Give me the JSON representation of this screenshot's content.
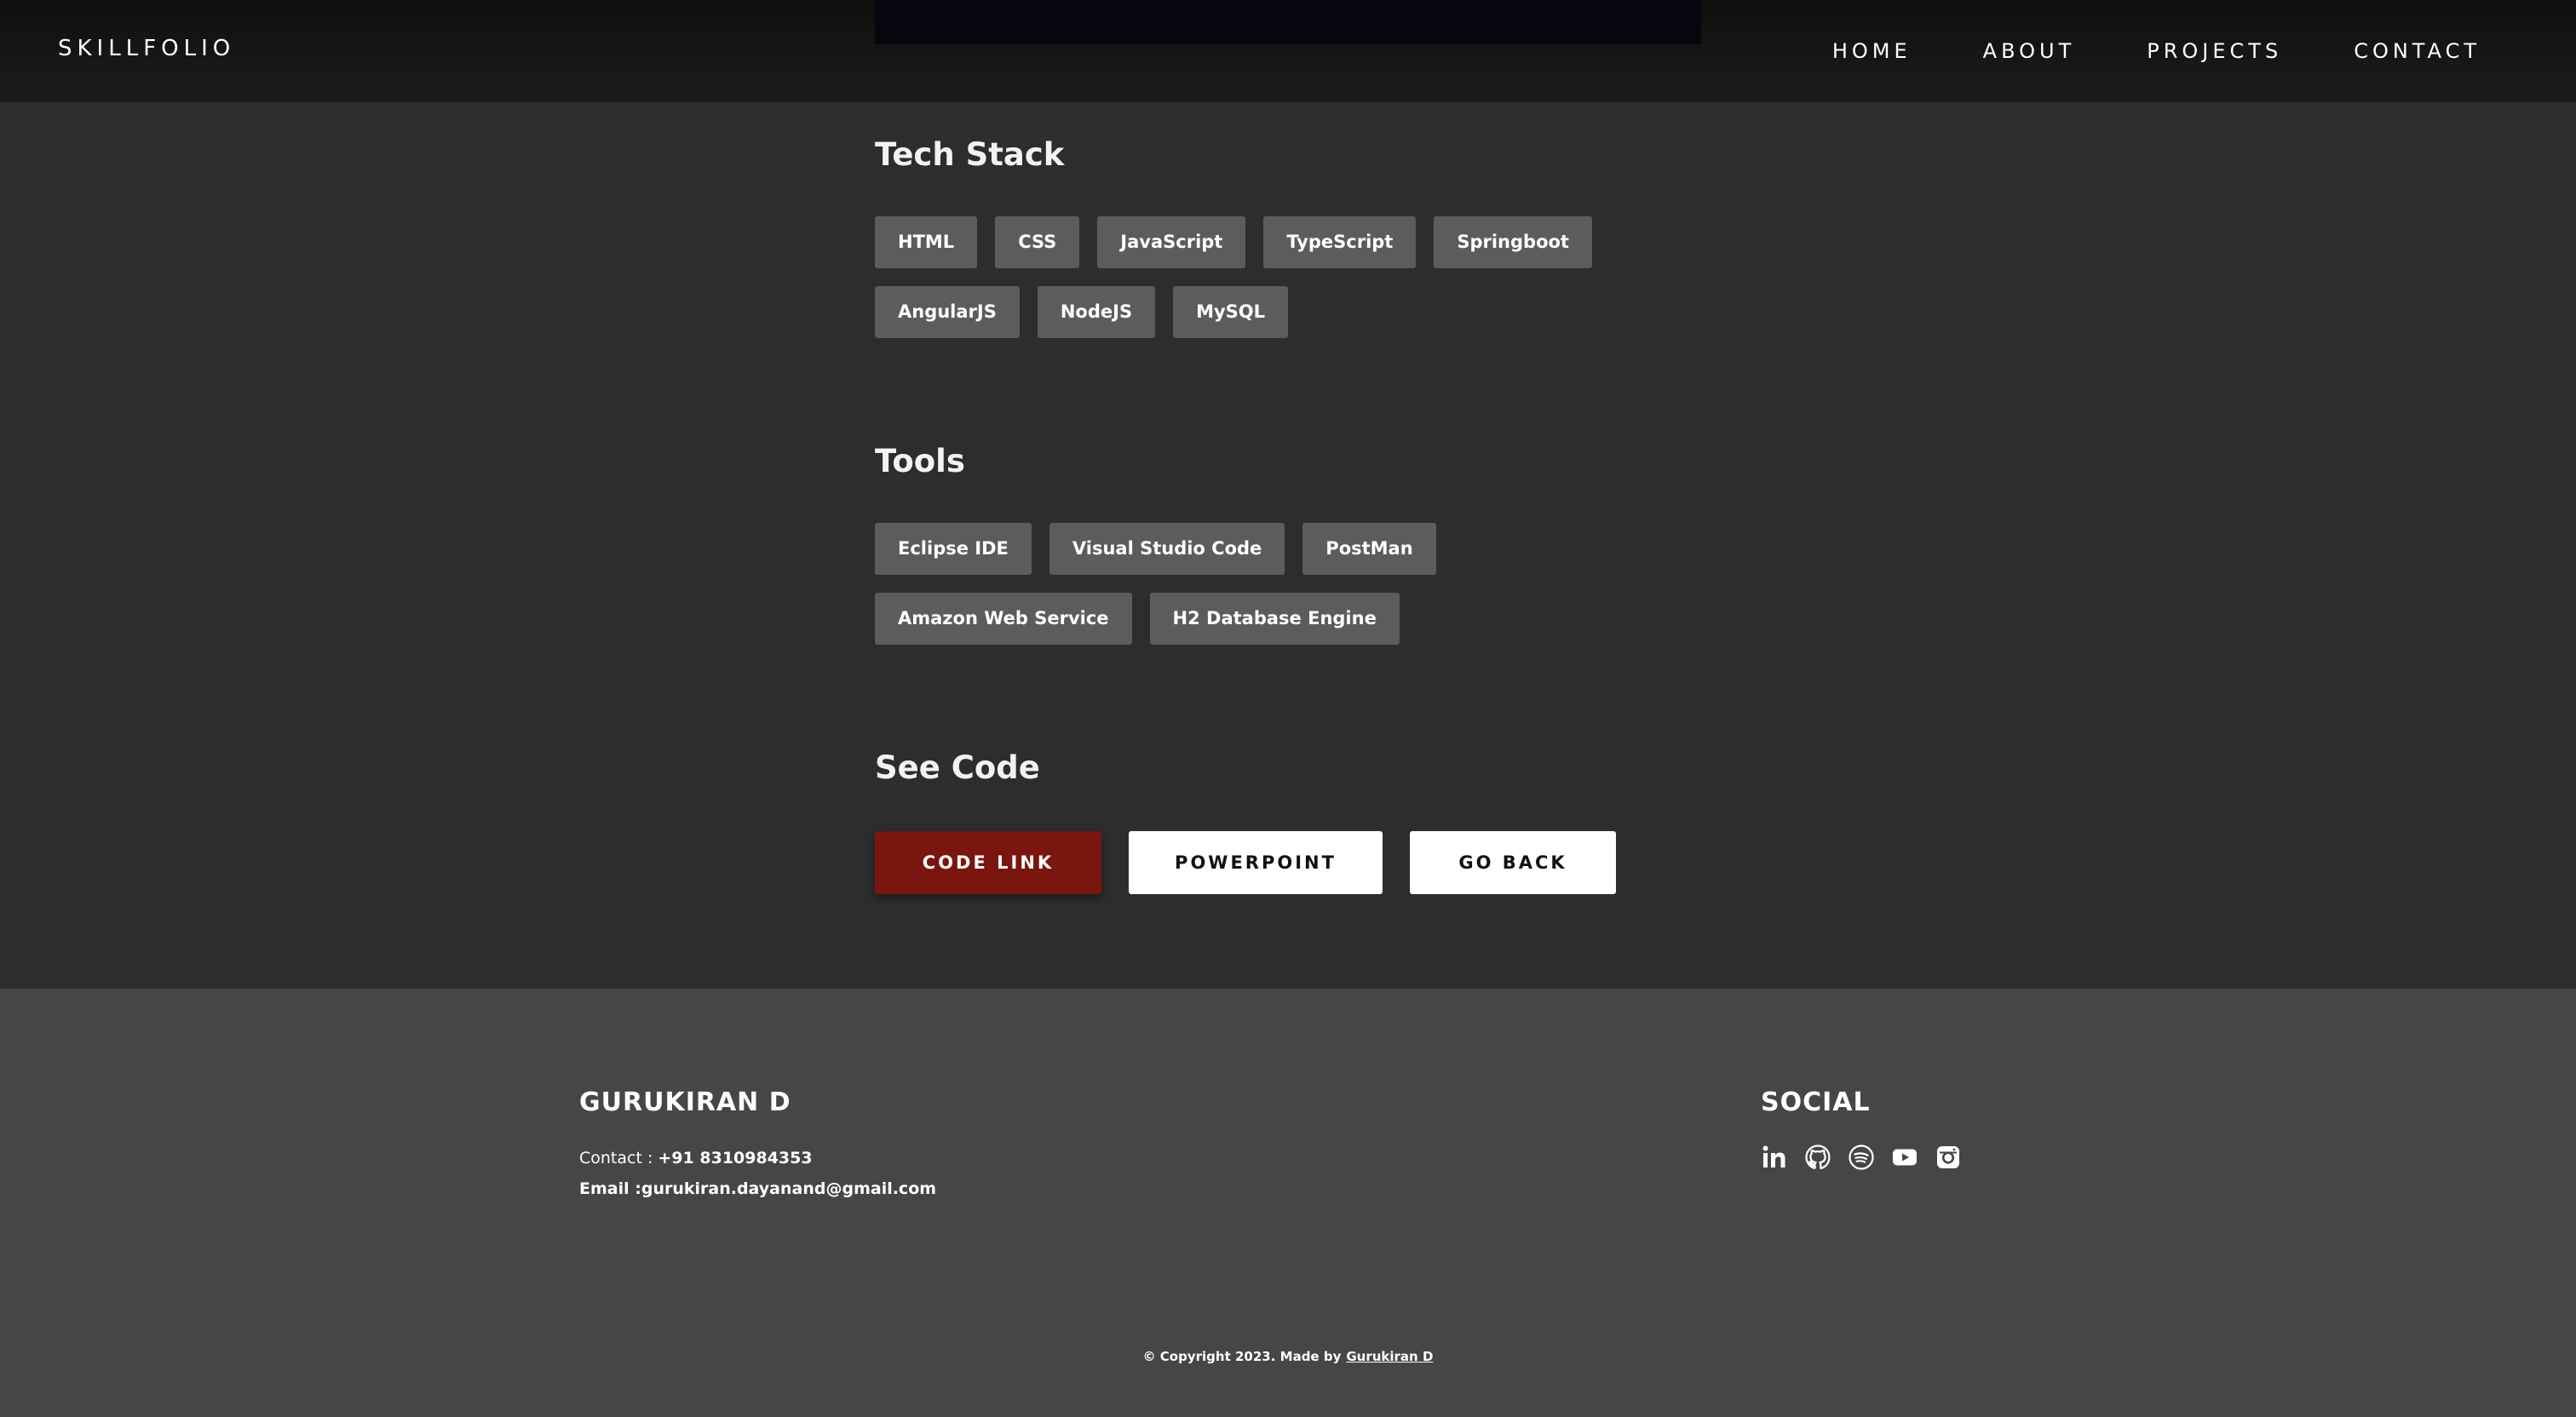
{
  "header": {
    "brand": "SKILLFOLIO",
    "nav": [
      "HOME",
      "ABOUT",
      "PROJECTS",
      "CONTACT"
    ]
  },
  "tech_stack": {
    "title": "Tech Stack",
    "items": [
      "HTML",
      "CSS",
      "JavaScript",
      "TypeScript",
      "Springboot",
      "AngularJS",
      "NodeJS",
      "MySQL"
    ]
  },
  "tools": {
    "title": "Tools",
    "items": [
      "Eclipse IDE",
      "Visual Studio Code",
      "PostMan",
      "Amazon Web Service",
      "H2 Database Engine"
    ]
  },
  "see_code": {
    "title": "See Code",
    "code_link": "CODE LINK",
    "powerpoint": "POWERPOINT",
    "go_back": "GO BACK"
  },
  "footer": {
    "name": "GURUKIRAN D",
    "contact_label": "Contact : ",
    "phone": "+91 8310984353",
    "email_label": "Email :",
    "email": "gurukiran.dayanand@gmail.com",
    "social_title": "SOCIAL",
    "social_icons": [
      "linkedin-icon",
      "github-icon",
      "spotify-icon",
      "youtube-icon",
      "instagram-icon"
    ],
    "copyright_text": "© Copyright 2023. Made by",
    "copyright_author": "Gurukiran D"
  },
  "colors": {
    "accent_red": "#7a1510",
    "page_bg": "#2d2d2d",
    "chip_bg": "#5c5c5c",
    "footer_bg": "#464646"
  }
}
